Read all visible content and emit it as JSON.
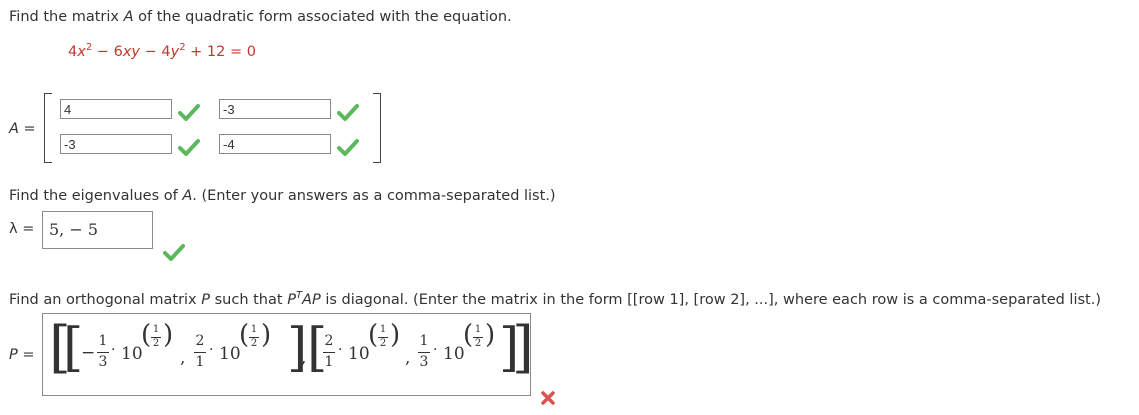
{
  "q1": {
    "prompt_pre": "Find the matrix ",
    "prompt_var": "A",
    "prompt_post": " of the quadratic form associated with the equation.",
    "equation": {
      "t1_coef": "4",
      "t1_var": "x",
      "t1_exp": "2",
      "op1": " − ",
      "t2_coef": "6",
      "t2_var": "xy",
      "op2": " − ",
      "t3_coef": "4",
      "t3_var": "y",
      "t3_exp": "2",
      "rest": " + 12 = 0"
    },
    "matrix_label": "A",
    "equals": "=",
    "cells": [
      {
        "value": "4",
        "correct": true
      },
      {
        "value": "-3",
        "correct": true
      },
      {
        "value": "-3",
        "correct": true
      },
      {
        "value": "-4",
        "correct": true
      }
    ]
  },
  "q2": {
    "prompt_pre": "Find the eigenvalues of ",
    "prompt_var": "A",
    "prompt_post": ". (Enter your answers as a comma-separated list.)",
    "label": "λ",
    "equals": "=",
    "answer": "5, − 5",
    "correct": true
  },
  "q3": {
    "prompt_pre": "Find an orthogonal matrix ",
    "prompt_var1": "P",
    "prompt_mid": " such that ",
    "prompt_var2": "P",
    "prompt_sup": "T",
    "prompt_var3": "AP",
    "prompt_post": " is diagonal. (Enter the matrix in the form [[row 1], [row 2], ...], where each row is a comma-separated list.)",
    "label": "P",
    "equals": "=",
    "answer": {
      "row1": [
        {
          "sign": "−",
          "num": "1",
          "den": "3",
          "base": "10",
          "exp_num": "1",
          "exp_den": "2"
        },
        {
          "sign": "",
          "num": "2",
          "den": "1",
          "base": "10",
          "exp_num": "1",
          "exp_den": "2"
        }
      ],
      "row2": [
        {
          "sign": "",
          "num": "2",
          "den": "1",
          "base": "10",
          "exp_num": "1",
          "exp_den": "2"
        },
        {
          "sign": "",
          "num": "1",
          "den": "3",
          "base": "10",
          "exp_num": "1",
          "exp_den": "2"
        }
      ],
      "dot": "·",
      "comma": ","
    },
    "correct": false
  },
  "colors": {
    "correct": "#5cb85c",
    "incorrect": "#d9534f",
    "equation": "#c0392b"
  },
  "icons": {
    "correct": "checkmark-icon",
    "incorrect": "x-mark-icon"
  }
}
